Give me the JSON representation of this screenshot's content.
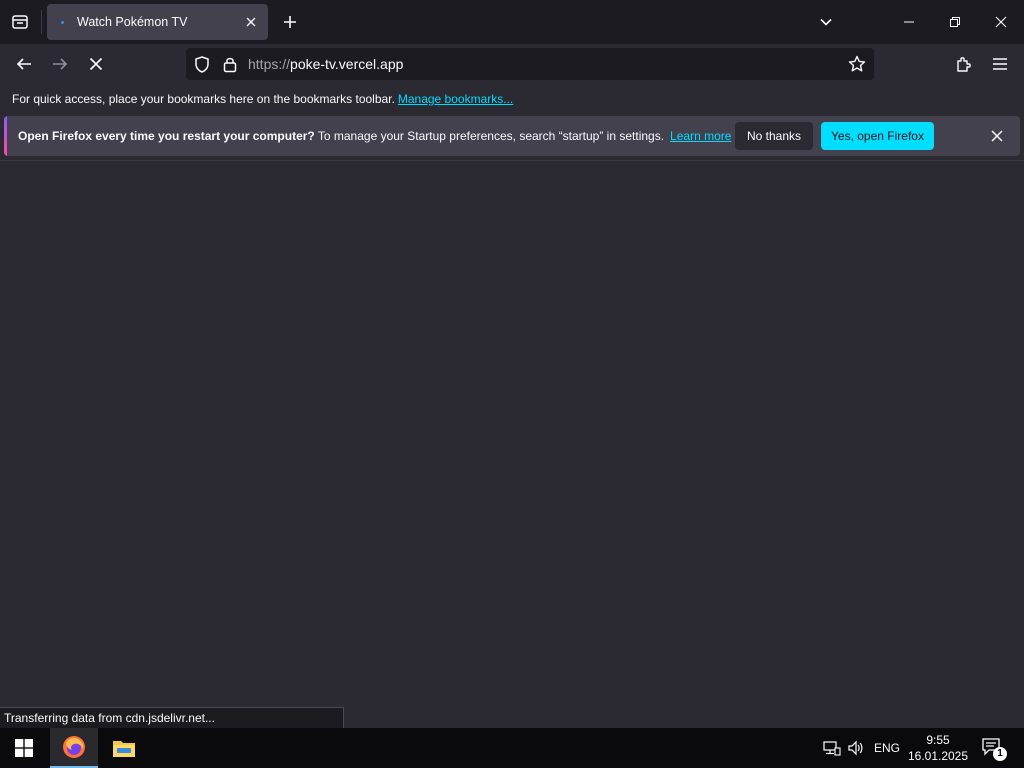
{
  "browser": {
    "tab": {
      "title": "Watch Pokémon TV"
    },
    "url": {
      "scheme": "https://",
      "host": "poke-tv.vercel.app"
    }
  },
  "bookmarks_bar": {
    "text": "For quick access, place your bookmarks here on the bookmarks toolbar.",
    "link": "Manage bookmarks..."
  },
  "notification": {
    "bold": "Open Firefox every time you restart your computer?",
    "text": " To manage your Startup preferences, search “startup” in settings.",
    "link": "Learn more",
    "secondary_button": "No thanks",
    "primary_button": "Yes, open Firefox"
  },
  "status": {
    "text": "Transferring data from cdn.jsdelivr.net..."
  },
  "taskbar": {
    "language": "ENG",
    "time": "9:55",
    "date": "16.01.2025",
    "notification_count": "1"
  },
  "icons": {
    "tab_list": "tab-list-icon",
    "close": "close-icon",
    "new_tab": "plus-icon",
    "back": "back-arrow-icon",
    "forward": "forward-arrow-icon",
    "stop": "stop-icon",
    "shield": "shield-icon",
    "lock": "lock-icon",
    "star": "star-icon",
    "extensions": "puzzle-icon",
    "menu": "hamburger-menu-icon"
  },
  "colors": {
    "accent": "#00ddff",
    "toolbar": "#2b2a33",
    "tabstrip": "#1c1b22"
  }
}
